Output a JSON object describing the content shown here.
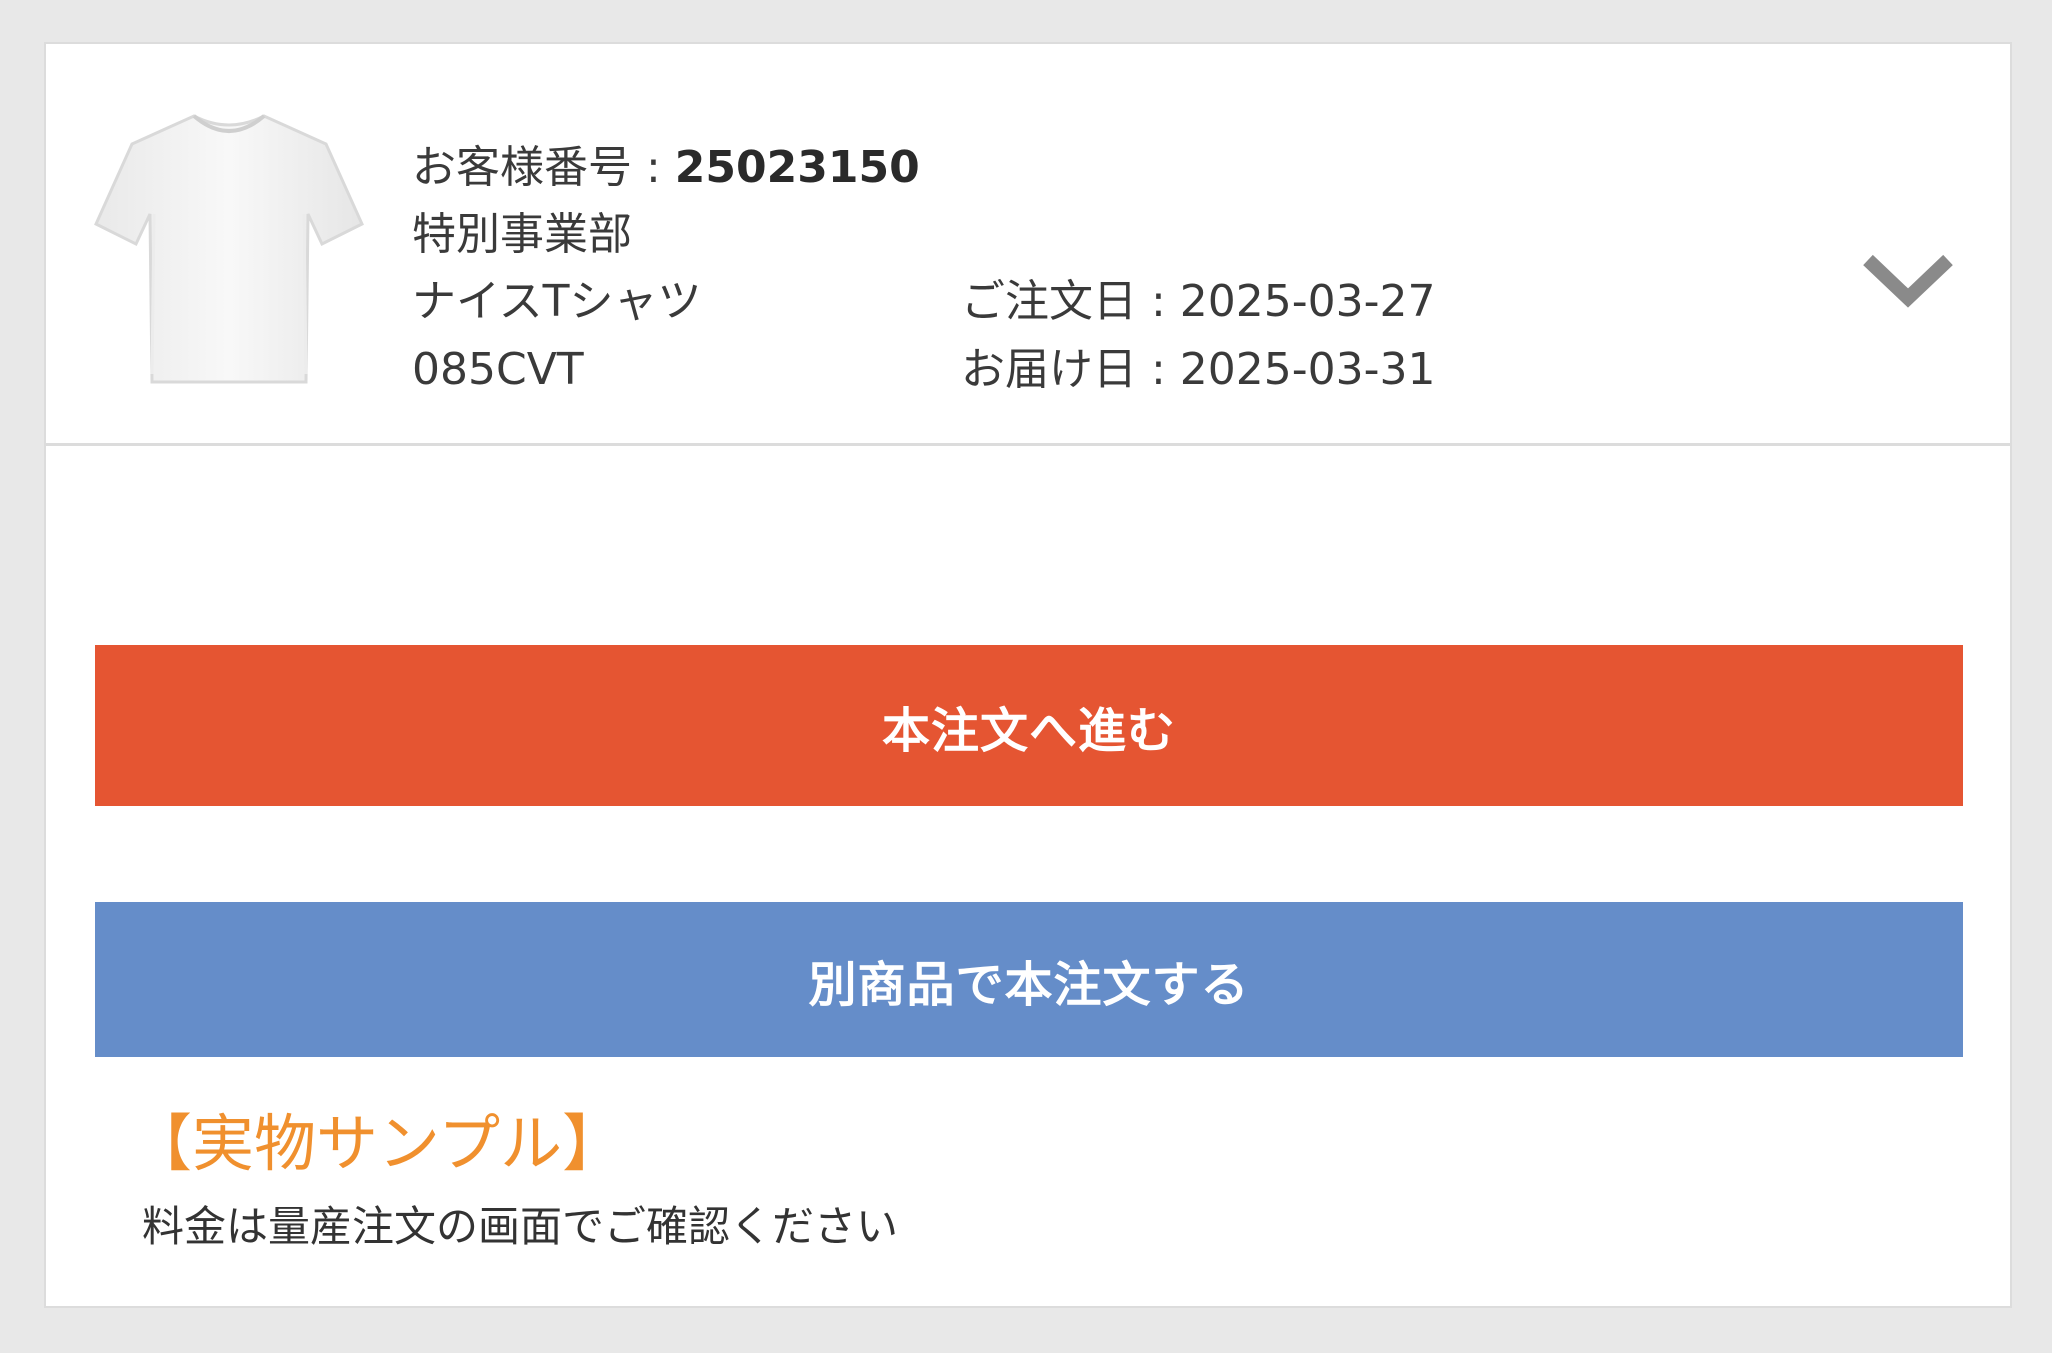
{
  "order": {
    "customer_number_label": "お客様番号 : ",
    "customer_number": "25023150",
    "department": "特別事業部",
    "product_name": "ナイスTシャツ",
    "product_code": "085CVT",
    "order_date_label": "ご注文日 : ",
    "order_date": "2025-03-27",
    "delivery_date_label": "お届け日 : ",
    "delivery_date": "2025-03-31",
    "thumbnail_icon": "tshirt-white"
  },
  "actions": {
    "proceed_label": "本注文へ進む",
    "other_product_label": "別商品で本注文する"
  },
  "sample": {
    "title": "【実物サンプル】",
    "note": "料金は量産注文の画面でご確認ください"
  },
  "colors": {
    "primary_button": "#e55532",
    "secondary_button": "#658dc9",
    "sample_title": "#f0902e",
    "page_background": "#e8e8e8"
  }
}
